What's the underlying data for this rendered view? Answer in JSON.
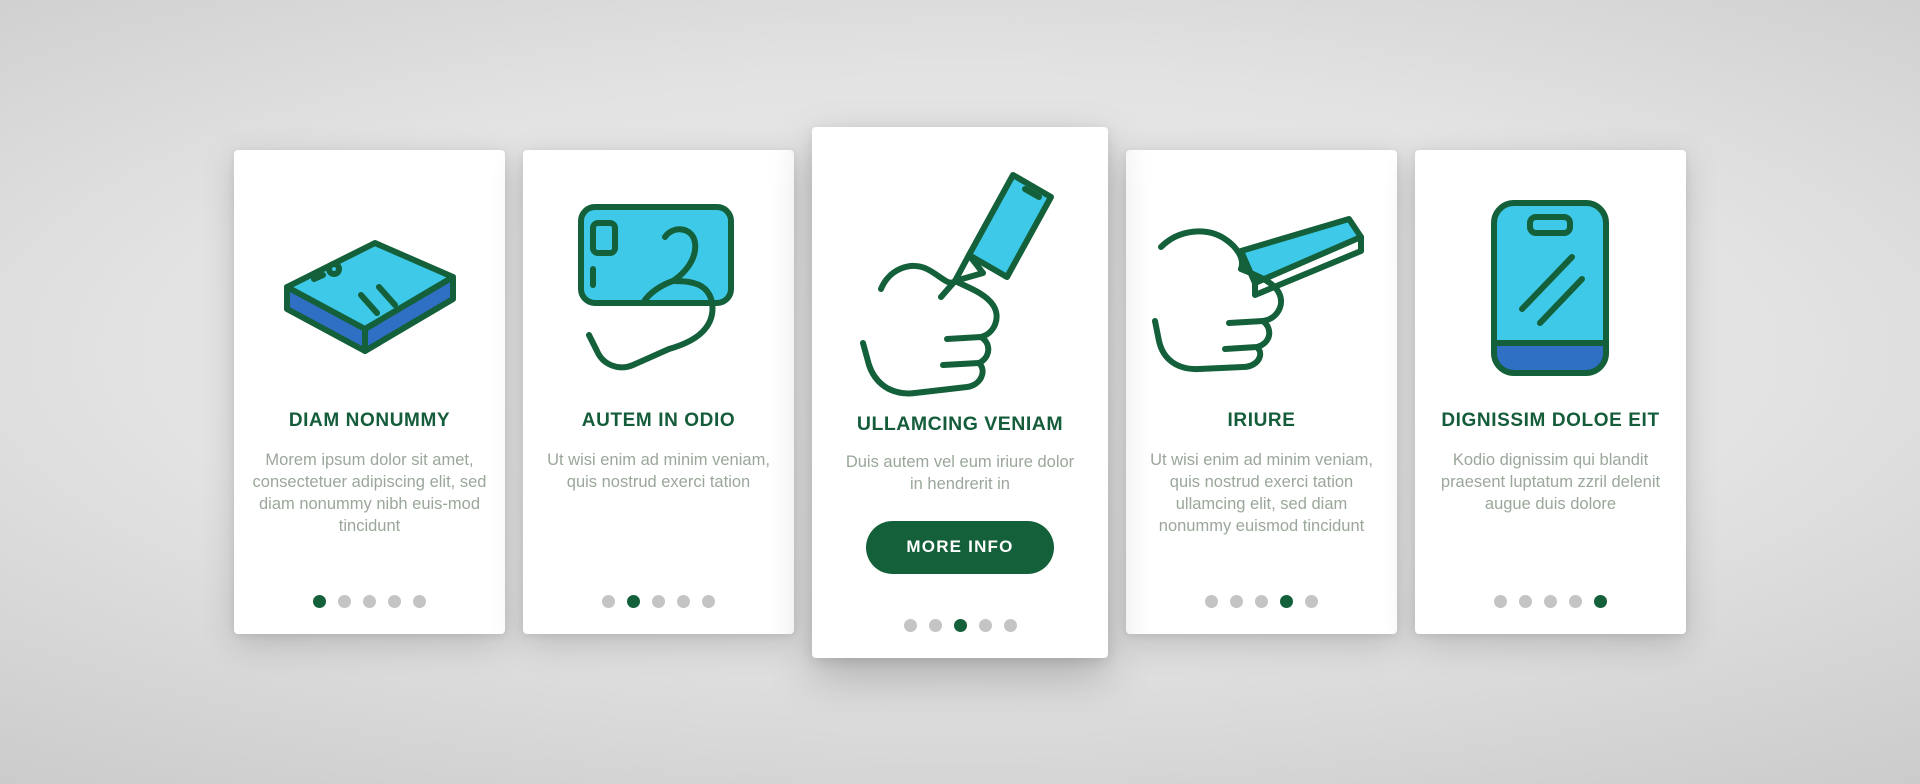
{
  "theme": {
    "accent_green": "#14603a",
    "illustration_fill": "#3fc9e8",
    "illustration_shadow": "#2f6fc4",
    "body_text": "#9aa79a",
    "dot_inactive": "#c4c4c4",
    "card_background": "#ffffff"
  },
  "cards": [
    {
      "title": "DIAM NONUMMY",
      "body": "Morem ipsum dolor sit amet, consectetuer adipiscing elit, sed diam nonummy nibh euis-mod tincidunt",
      "illustration": "phone-lying-flat-icon",
      "dots": 5,
      "active_dot": 1,
      "featured": false,
      "cta": null
    },
    {
      "title": "AUTEM IN ODIO",
      "body": "Ut wisi enim ad minim veniam, quis nostrud exerci tation",
      "illustration": "hand-holding-phone-landscape-icon",
      "dots": 5,
      "active_dot": 2,
      "featured": false,
      "cta": null
    },
    {
      "title": "ULLAMCING VENIAM",
      "body": "Duis autem vel eum iriure dolor in hendrerit in",
      "illustration": "hand-holding-phone-upright-icon",
      "dots": 5,
      "active_dot": 3,
      "featured": true,
      "cta": "MORE INFO"
    },
    {
      "title": "IRIURE",
      "body": "Ut wisi enim ad minim veniam, quis nostrud exerci tation ullamcing elit, sed diam nonummy euismod tincidunt",
      "illustration": "hand-passing-phone-icon",
      "dots": 5,
      "active_dot": 4,
      "featured": false,
      "cta": null
    },
    {
      "title": "DIGNISSIM DOLOE EIT",
      "body": "Kodio dignissim qui blandit praesent luptatum zzril delenit augue duis dolore",
      "illustration": "phone-front-view-icon",
      "dots": 5,
      "active_dot": 5,
      "featured": false,
      "cta": null
    }
  ]
}
